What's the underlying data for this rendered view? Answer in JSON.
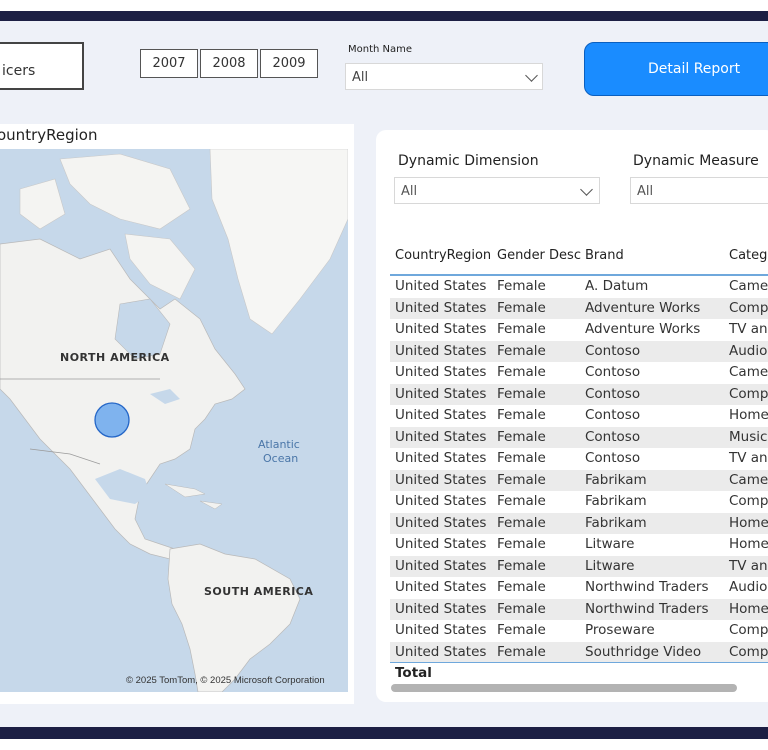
{
  "slicers": {
    "label": "icers"
  },
  "years": [
    "2007",
    "2008",
    "2009"
  ],
  "month": {
    "label": "Month Name",
    "value": "All"
  },
  "detail_button": "Detail Report",
  "map": {
    "title": "ountryRegion",
    "labels": {
      "north_america": "NORTH AMERICA",
      "south_america": "SOUTH AMERICA",
      "ocean1": "Atlantic",
      "ocean2": "Ocean"
    },
    "copyright": "© 2025 TomTom, © 2025 Microsoft Corporation"
  },
  "dynamic_dimension": {
    "label": "Dynamic Dimension",
    "value": "All"
  },
  "dynamic_measure": {
    "label": "Dynamic Measure",
    "value": "All"
  },
  "table": {
    "columns": [
      "CountryRegion",
      "Gender Desc",
      "Brand",
      "Catego"
    ],
    "rows": [
      [
        "United States",
        "Female",
        "A. Datum",
        "Camer"
      ],
      [
        "United States",
        "Female",
        "Adventure Works",
        "Compu"
      ],
      [
        "United States",
        "Female",
        "Adventure Works",
        "TV and"
      ],
      [
        "United States",
        "Female",
        "Contoso",
        "Audio"
      ],
      [
        "United States",
        "Female",
        "Contoso",
        "Camer"
      ],
      [
        "United States",
        "Female",
        "Contoso",
        "Compu"
      ],
      [
        "United States",
        "Female",
        "Contoso",
        "Home"
      ],
      [
        "United States",
        "Female",
        "Contoso",
        "Music,"
      ],
      [
        "United States",
        "Female",
        "Contoso",
        "TV and"
      ],
      [
        "United States",
        "Female",
        "Fabrikam",
        "Camer"
      ],
      [
        "United States",
        "Female",
        "Fabrikam",
        "Compu"
      ],
      [
        "United States",
        "Female",
        "Fabrikam",
        "Home"
      ],
      [
        "United States",
        "Female",
        "Litware",
        "Home"
      ],
      [
        "United States",
        "Female",
        "Litware",
        "TV and"
      ],
      [
        "United States",
        "Female",
        "Northwind Traders",
        "Audio"
      ],
      [
        "United States",
        "Female",
        "Northwind Traders",
        "Home"
      ],
      [
        "United States",
        "Female",
        "Proseware",
        "Compu"
      ],
      [
        "United States",
        "Female",
        "Southridge Video",
        "Compu"
      ]
    ],
    "total_label": "Total"
  }
}
